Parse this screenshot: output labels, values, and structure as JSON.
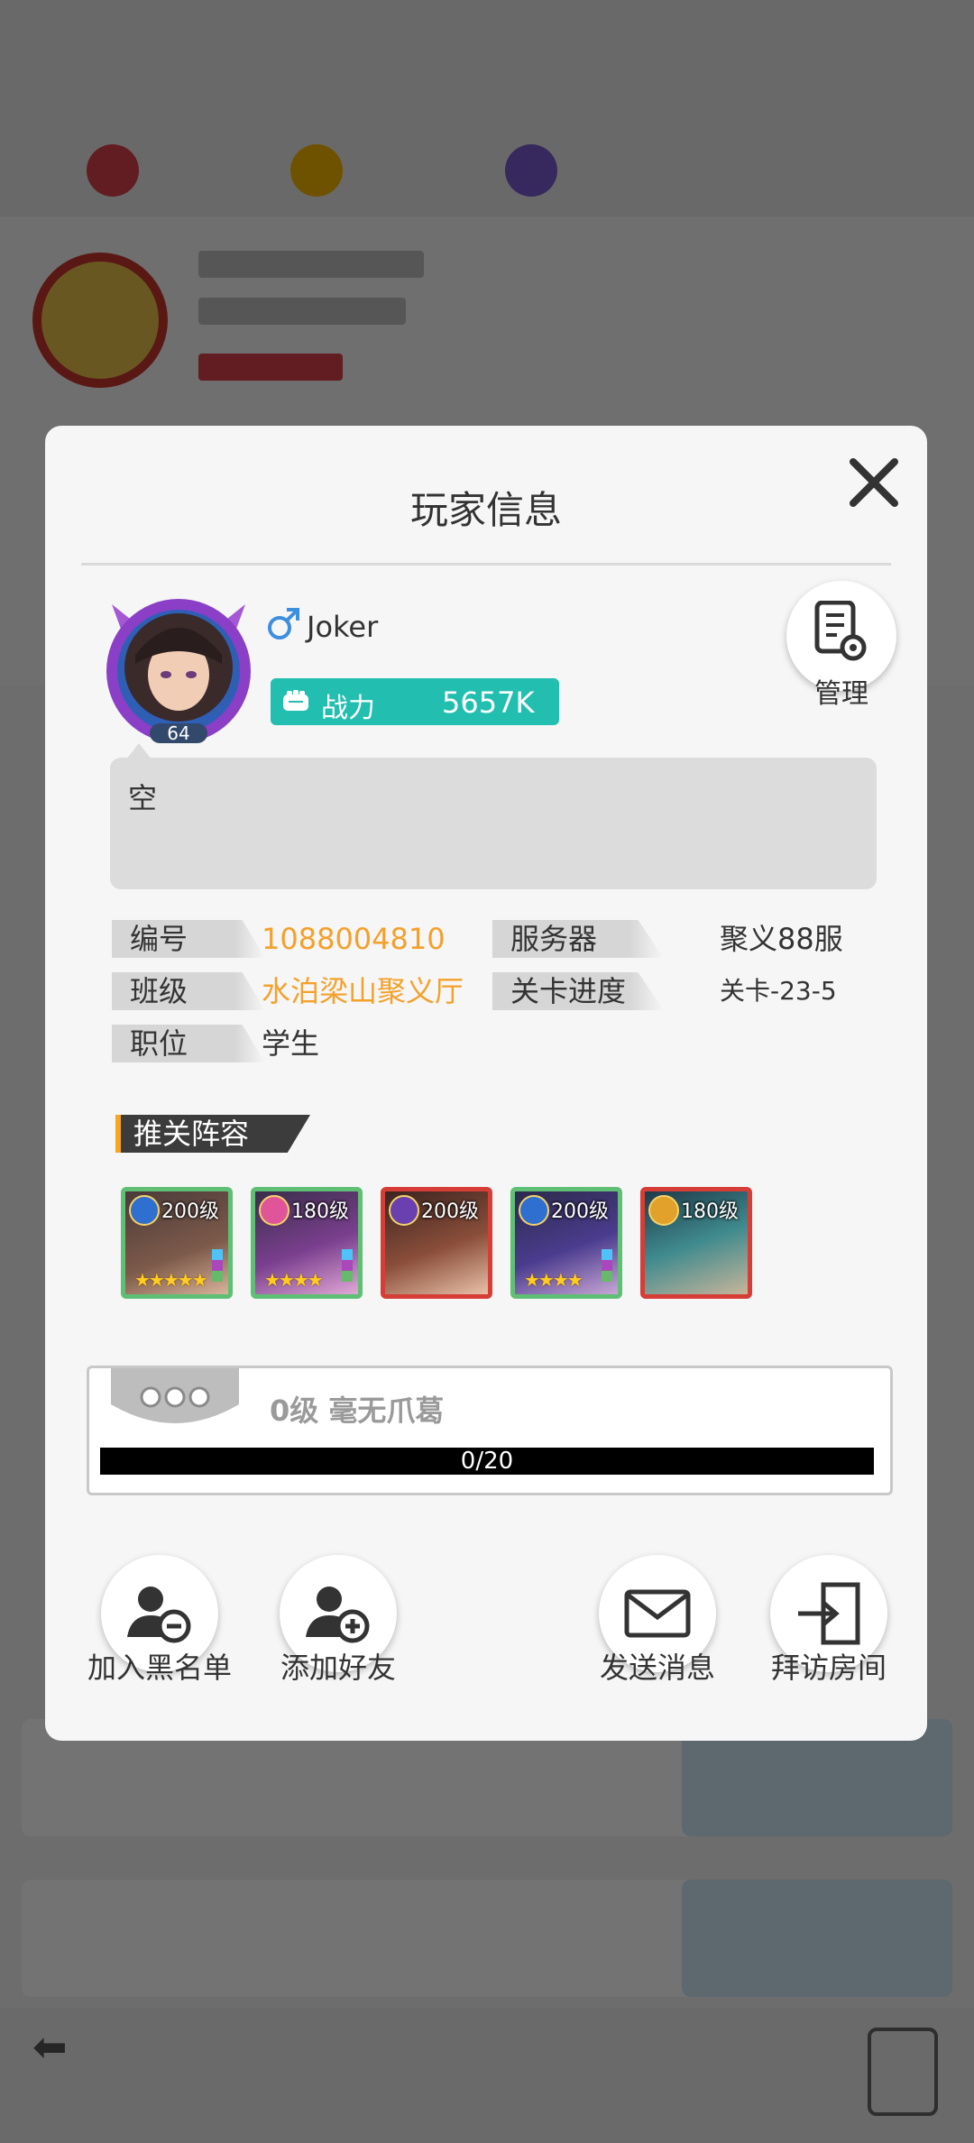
{
  "dialog": {
    "title": "玩家信息",
    "close_icon": "close-icon"
  },
  "player": {
    "level": "64",
    "gender_icon": "male-icon",
    "name": "Joker",
    "power_label": "战力",
    "power_value": "5657K",
    "signature": "空"
  },
  "manage": {
    "label": "管理",
    "icon": "document-gear-icon"
  },
  "info": {
    "id_label": "编号",
    "id_value": "1088004810",
    "server_label": "服务器",
    "server_value": "聚义88服",
    "class_label": "班级",
    "class_value": "水泊梁山聚义厅",
    "stage_label": "关卡进度",
    "stage_value": "关卡-23-5",
    "position_label": "职位",
    "position_value": "学生"
  },
  "lineup": {
    "title": "推关阵容",
    "heroes": [
      {
        "level": "200级",
        "stars": "★★★★★",
        "element": "water",
        "frame": "#5fbf74"
      },
      {
        "level": "180级",
        "stars": "★★★★",
        "element": "heart",
        "frame": "#5fbf74"
      },
      {
        "level": "200级",
        "stars": "",
        "element": "moon",
        "frame": "#d63d37"
      },
      {
        "level": "200级",
        "stars": "★★★★",
        "element": "water",
        "frame": "#5fbf74"
      },
      {
        "level": "180级",
        "stars": "",
        "element": "sun",
        "frame": "#d63d37"
      }
    ]
  },
  "rank": {
    "title": "0级 毫无爪葛",
    "progress_text": "0/20",
    "progress": 0
  },
  "actions": {
    "blacklist": "加入黑名单",
    "add_friend": "添加好友",
    "message": "发送消息",
    "visit": "拜访房间"
  },
  "colors": {
    "accent_teal": "#22bfb0",
    "orange_value": "#f5a02a",
    "frame_red": "#d63d37"
  }
}
